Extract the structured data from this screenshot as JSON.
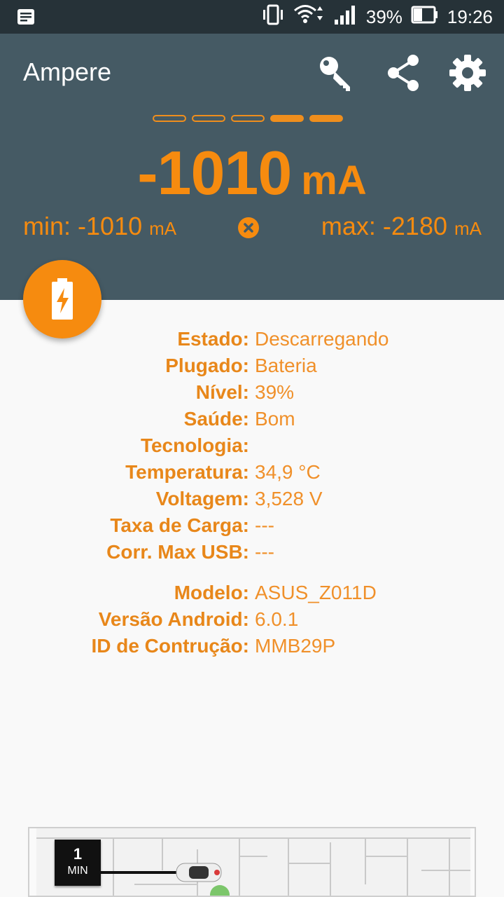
{
  "status_bar": {
    "battery_percent": "39%",
    "time": "19:26"
  },
  "toolbar": {
    "title": "Ampere"
  },
  "meter": {
    "range_dots": [
      false,
      false,
      false,
      true,
      true
    ],
    "current_value": "-1010",
    "current_unit": "mA",
    "min_label": "min:",
    "min_value": "-1010",
    "min_unit": "mA",
    "max_label": "max:",
    "max_value": "-2180",
    "max_unit": "mA"
  },
  "battery_info": [
    {
      "label": "Estado:",
      "value": "Descarregando"
    },
    {
      "label": "Plugado:",
      "value": "Bateria"
    },
    {
      "label": "Nível:",
      "value": "39%"
    },
    {
      "label": "Saúde:",
      "value": "Bom"
    },
    {
      "label": "Tecnologia:",
      "value": ""
    },
    {
      "label": "Temperatura:",
      "value": "34,9 °C"
    },
    {
      "label": "Voltagem:",
      "value": "3,528 V"
    },
    {
      "label": "Taxa de Carga:",
      "value": "---"
    },
    {
      "label": "Corr. Max USB:",
      "value": "---"
    }
  ],
  "device_info": [
    {
      "label": "Modelo:",
      "value": "ASUS_Z011D"
    },
    {
      "label": "Versão Android:",
      "value": "6.0.1"
    },
    {
      "label": "ID de Contrução:",
      "value": "MMB29P"
    }
  ],
  "ad": {
    "timer_number": "1",
    "timer_unit": "MIN"
  },
  "colors": {
    "status_bar": "#263238",
    "app_bar": "#455a64",
    "accent": "#f68b0f",
    "label": "#e8871a",
    "background": "#f9f9f9"
  },
  "icons": [
    "notification-icon",
    "vibrate-icon",
    "wifi-icon",
    "signal-icon",
    "battery-icon",
    "key-icon",
    "share-icon",
    "settings-icon",
    "reset-icon",
    "battery-charging-icon"
  ]
}
